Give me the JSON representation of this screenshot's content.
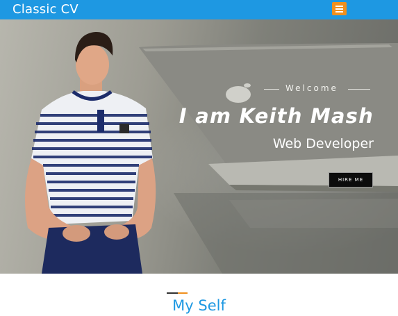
{
  "header": {
    "brand": "Classic CV",
    "menu_icon": "hamburger-menu-icon"
  },
  "hero": {
    "welcome": "Welcome",
    "name": "I am Keith Mash",
    "role": "Web Developer",
    "hire_button": "HIRE ME"
  },
  "section": {
    "title": "My Self"
  },
  "colors": {
    "brand_blue": "#1e98e2",
    "accent_orange": "#f0901e",
    "button_black": "#0c0c0c"
  }
}
